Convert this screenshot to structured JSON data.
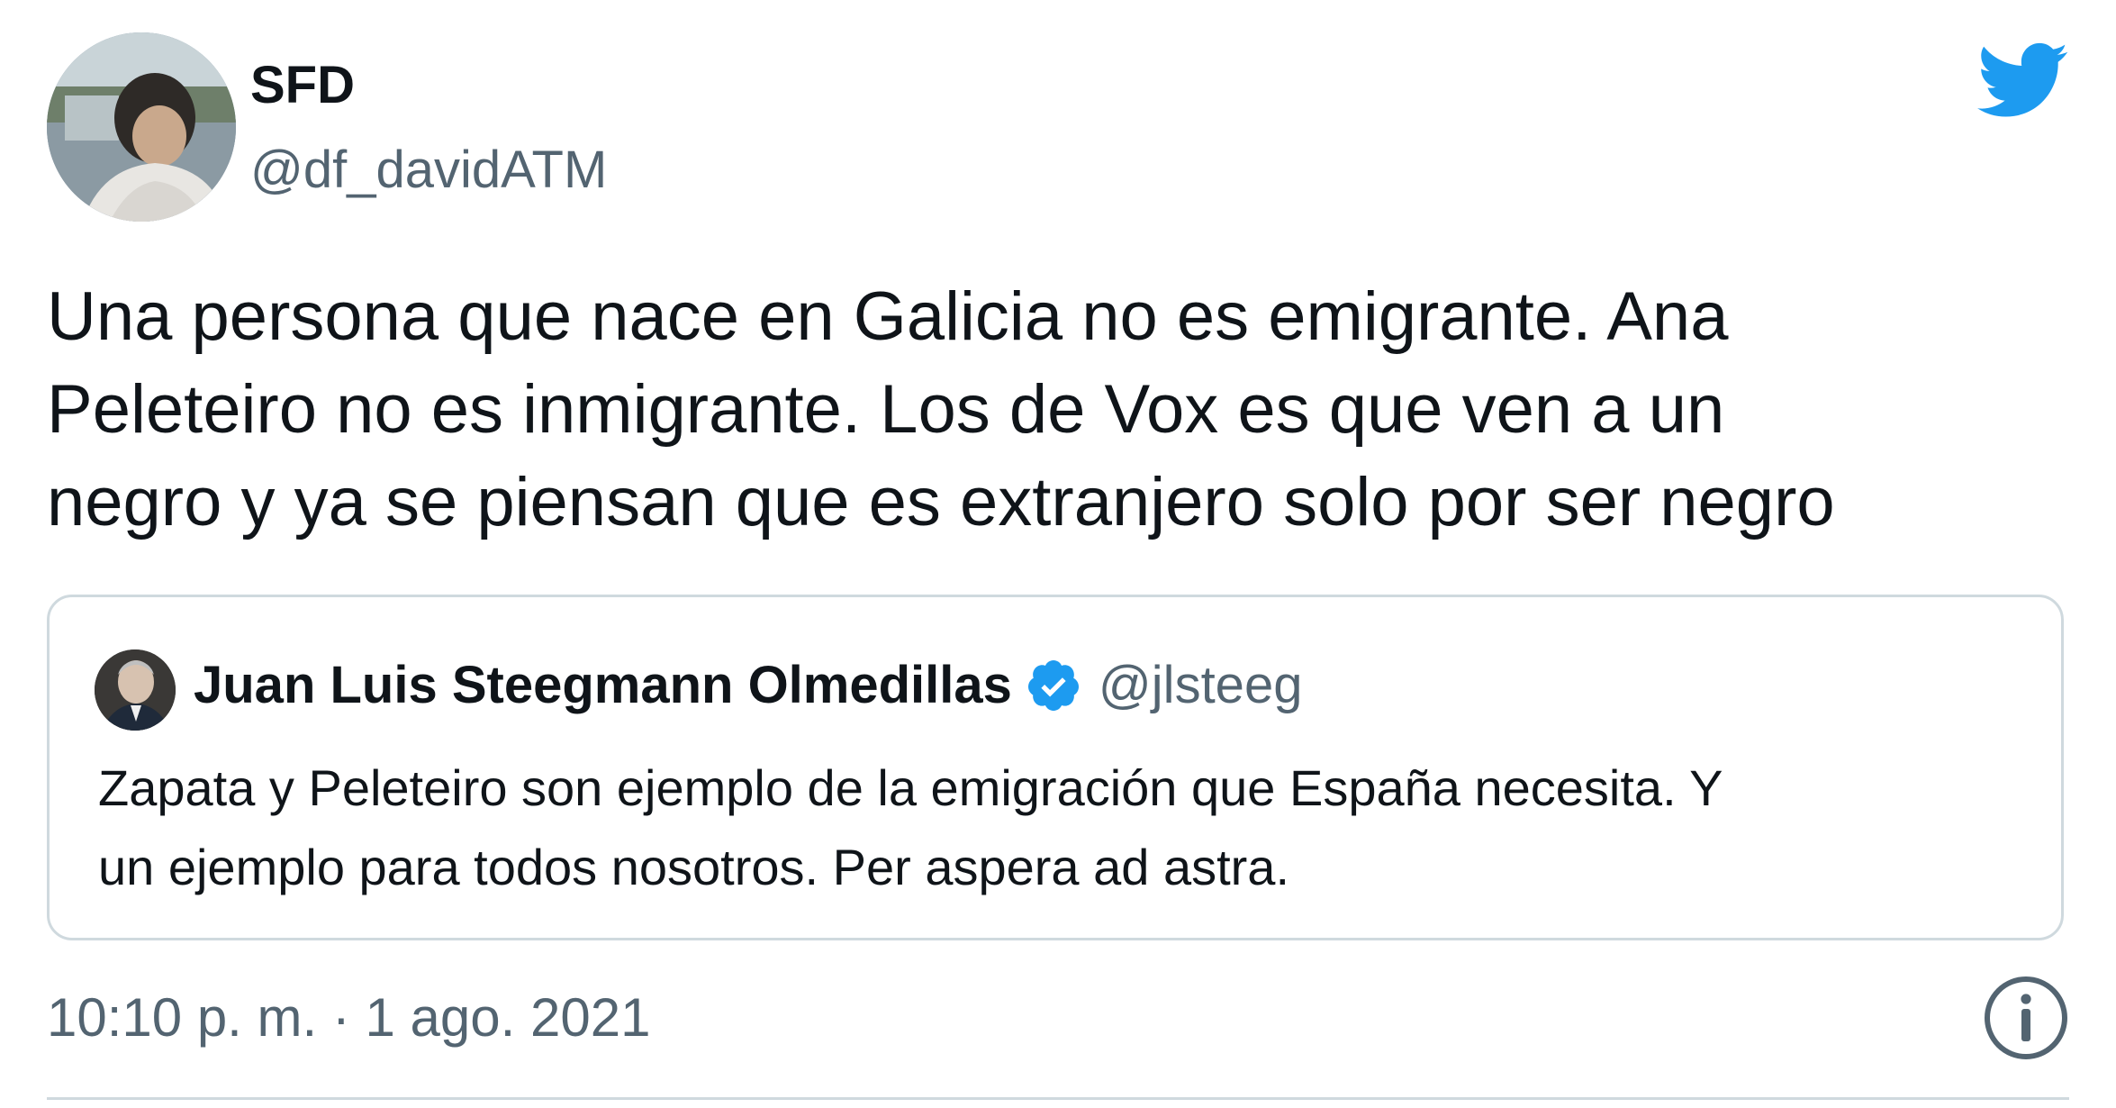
{
  "tweet": {
    "author": {
      "name": "SFD",
      "handle": "@df_davidATM"
    },
    "text_lines": [
      "Una persona que nace en Galicia no es emigrante. Ana",
      "Peleteiro no es inmigrante. Los de Vox es que ven a un",
      "negro y ya se piensan que es extranjero solo por ser negro"
    ],
    "timestamp": "10:10 p. m. · 1 ago. 2021"
  },
  "quoted_tweet": {
    "author": {
      "name": "Juan Luis Steegmann Olmedillas",
      "handle": "@jlsteeg",
      "verified": true
    },
    "text_lines": [
      "Zapata y Peleteiro son  ejemplo de la emigración que España necesita. Y",
      "un ejemplo para todos nosotros. Per aspera  ad astra."
    ]
  },
  "icons": {
    "brand": "twitter-bird-icon",
    "verified": "verified-badge-icon",
    "info": "info-icon"
  },
  "colors": {
    "twitter_blue": "#1d9bf0",
    "text_primary": "#0f1419",
    "text_secondary": "#536471",
    "border": "#cfd9de"
  }
}
